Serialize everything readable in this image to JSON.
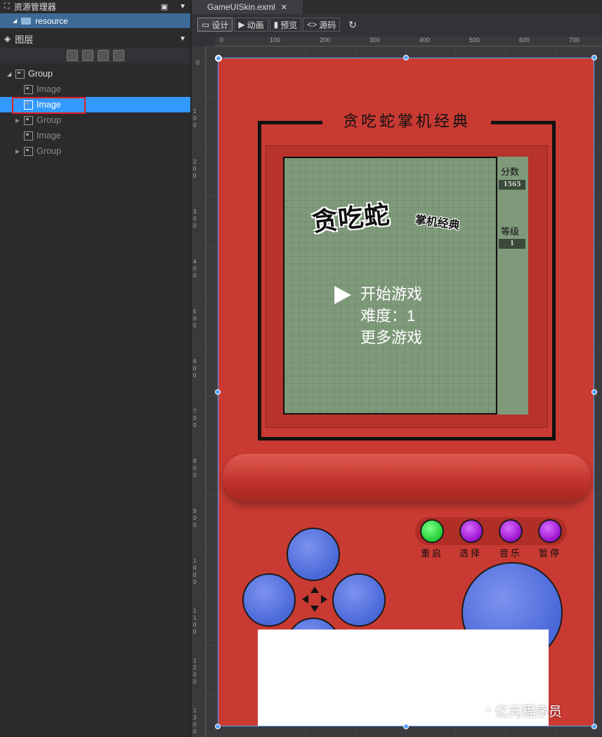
{
  "left_panel": {
    "resource_manager_title": "资源管理器",
    "resource_item": "resource",
    "layers_title": "图层",
    "tree": [
      {
        "label": "Group",
        "level": 0,
        "expanded": true,
        "selected": false,
        "dim": false
      },
      {
        "label": "Image",
        "level": 1,
        "expanded": false,
        "selected": false,
        "dim": true
      },
      {
        "label": "Image",
        "level": 1,
        "expanded": false,
        "selected": true,
        "dim": false
      },
      {
        "label": "Group",
        "level": 1,
        "expanded": false,
        "selected": false,
        "dim": true
      },
      {
        "label": "Image",
        "level": 1,
        "expanded": false,
        "selected": false,
        "dim": true
      },
      {
        "label": "Group",
        "level": 1,
        "expanded": false,
        "selected": false,
        "dim": true
      }
    ]
  },
  "editor": {
    "tab_title": "GameUISkin.exml",
    "toolbar": {
      "design": "设计",
      "animation": "动画",
      "preview": "预览",
      "source": "源码"
    },
    "ruler_top": [
      "0",
      "100",
      "200",
      "300",
      "400",
      "500",
      "600",
      "700"
    ],
    "ruler_left": [
      "0",
      "100",
      "200",
      "300",
      "400",
      "500",
      "600",
      "700",
      "800",
      "900",
      "1000",
      "1100",
      "1200",
      "1300"
    ]
  },
  "game": {
    "frame_title": "贪吃蛇掌机经典",
    "logo_big": "贪吃蛇",
    "logo_small": "掌机经典",
    "score_label": "分数",
    "score_value": "1565",
    "level_label": "等级",
    "level_value": "1",
    "menu": {
      "start": "开始游戏",
      "difficulty": "难度：1",
      "more": "更多游戏"
    },
    "buttons": [
      {
        "label": "重启",
        "color": "#22cc33"
      },
      {
        "label": "选择",
        "color": "#9a11cc"
      },
      {
        "label": "音乐",
        "color": "#9a11cc"
      },
      {
        "label": "暂停",
        "color": "#9a11cc"
      }
    ],
    "device_color": "#c83a32",
    "dpad_color": "#4a68d8"
  },
  "watermark": "亿元程序员"
}
